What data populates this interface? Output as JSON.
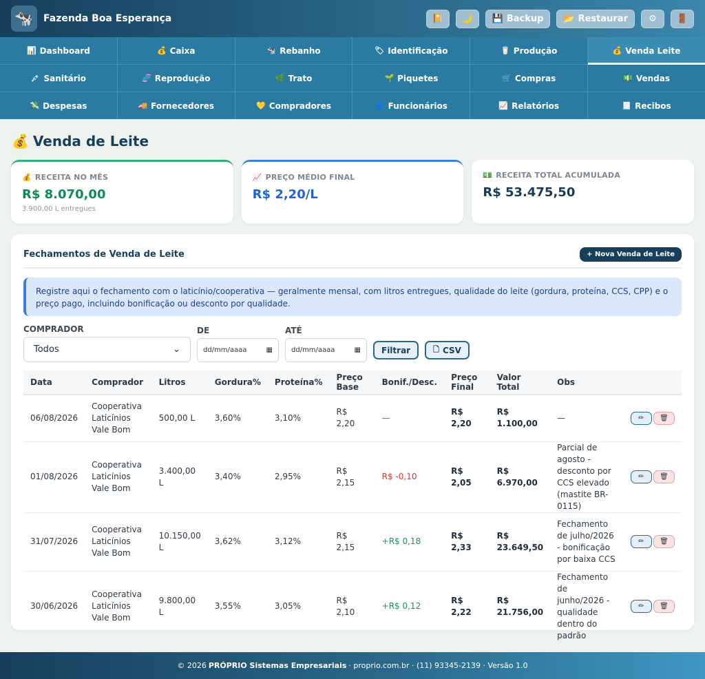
{
  "app": {
    "name": "Fazenda Boa Esperança",
    "logo_icon": "🐄"
  },
  "header": {
    "actions": [
      {
        "name": "notebook-button",
        "icon": "📔",
        "label": ""
      },
      {
        "name": "dark-mode-button",
        "icon": "🌙",
        "label": ""
      },
      {
        "name": "backup-button",
        "icon": "💾",
        "label": "Backup"
      },
      {
        "name": "restore-button",
        "icon": "📂",
        "label": "Restaurar"
      },
      {
        "name": "settings-button",
        "icon": "⚙",
        "label": ""
      },
      {
        "name": "logout-button",
        "icon": "🚪",
        "label": ""
      }
    ]
  },
  "nav": {
    "rows": [
      [
        {
          "icon": "📊",
          "label": "Dashboard"
        },
        {
          "icon": "💰",
          "label": "Caixa"
        },
        {
          "icon": "🐄",
          "label": "Rebanho"
        },
        {
          "icon": "🏷",
          "label": "Identificação"
        },
        {
          "icon": "🥛",
          "label": "Produção"
        },
        {
          "icon": "💰",
          "label": "Venda Leite",
          "active": true
        }
      ],
      [
        {
          "icon": "💉",
          "label": "Sanitário"
        },
        {
          "icon": "🧬",
          "label": "Reprodução"
        },
        {
          "icon": "🌿",
          "label": "Trato"
        },
        {
          "icon": "🌱",
          "label": "Piquetes"
        },
        {
          "icon": "🛒",
          "label": "Compras"
        },
        {
          "icon": "💵",
          "label": "Vendas"
        }
      ],
      [
        {
          "icon": "💸",
          "label": "Despesas"
        },
        {
          "icon": "🚚",
          "label": "Fornecedores"
        },
        {
          "icon": "💛",
          "label": "Compradores"
        },
        {
          "icon": "👤",
          "label": "Funcionários"
        },
        {
          "icon": "📈",
          "label": "Relatórios"
        },
        {
          "icon": "🧾",
          "label": "Recibos"
        }
      ]
    ]
  },
  "page": {
    "title": "Venda de Leite",
    "title_icon": "💰"
  },
  "cards": [
    {
      "icon": "💰",
      "label": "RECEITA NO MÊS",
      "value": "R$ 8.070,00",
      "sub": "3.900,00 L entregues",
      "accent": "#2fb07a"
    },
    {
      "icon": "📈",
      "label": "PREÇO MÉDIO FINAL",
      "value": "R$ 2,20/L",
      "sub": "",
      "accent": "#3a7fdc"
    },
    {
      "icon": "💵",
      "label": "RECEITA TOTAL ACUMULADA",
      "value": "R$ 53.475,50",
      "sub": "",
      "accent": ""
    }
  ],
  "panel": {
    "title": "Fechamentos de Venda de Leite",
    "new_button": "+ Nova Venda de Leite",
    "info": "Registre aqui o fechamento com o laticínio/cooperativa — geralmente mensal, com litros entregues, qualidade do leite (gordura, proteína, CCS, CPP) e o preço pago, incluindo bonificação ou desconto por qualidade."
  },
  "filters": {
    "buyer_label": "COMPRADOR",
    "buyer_value": "Todos",
    "from_label": "DE",
    "to_label": "ATÉ",
    "date_placeholder": "dd/mm/aaaa",
    "filter_button": "Filtrar",
    "csv_button": "CSV"
  },
  "table": {
    "columns": [
      "Data",
      "Comprador",
      "Litros",
      "Gordura%",
      "Proteína%",
      "Preço Base",
      "Bonif./Desc.",
      "Preço Final",
      "Valor Total",
      "Obs"
    ],
    "rows": [
      {
        "data": "06/08/2026",
        "comprador": "Cooperativa Laticínios Vale Bom",
        "litros": "500,00 L",
        "gordura": "3,60%",
        "proteina": "3,10%",
        "preco_base": "R$ 2,20",
        "bonif": "—",
        "bonif_type": "none",
        "preco_final": "R$ 2,20",
        "valor_total": "R$ 1.100,00",
        "obs": "—"
      },
      {
        "data": "01/08/2026",
        "comprador": "Cooperativa Laticínios Vale Bom",
        "litros": "3.400,00 L",
        "gordura": "3,40%",
        "proteina": "2,95%",
        "preco_base": "R$ 2,15",
        "bonif": "R$ -0,10",
        "bonif_type": "neg",
        "preco_final": "R$ 2,05",
        "valor_total": "R$ 6.970,00",
        "obs": "Parcial de agosto - desconto por CCS elevado (mastite BR-0115)"
      },
      {
        "data": "31/07/2026",
        "comprador": "Cooperativa Laticínios Vale Bom",
        "litros": "10.150,00 L",
        "gordura": "3,62%",
        "proteina": "3,12%",
        "preco_base": "R$ 2,15",
        "bonif": "+R$ 0,18",
        "bonif_type": "pos",
        "preco_final": "R$ 2,33",
        "valor_total": "R$ 23.649,50",
        "obs": "Fechamento de julho/2026 - bonificação por baixa CCS"
      },
      {
        "data": "30/06/2026",
        "comprador": "Cooperativa Laticínios Vale Bom",
        "litros": "9.800,00 L",
        "gordura": "3,55%",
        "proteina": "3,05%",
        "preco_base": "R$ 2,10",
        "bonif": "+R$ 0,12",
        "bonif_type": "pos",
        "preco_final": "R$ 2,22",
        "valor_total": "R$ 21.756,00",
        "obs": "Fechamento de junho/2026 - qualidade dentro do padrão"
      }
    ],
    "edit_icon": "✏",
    "delete_icon": "🗑"
  },
  "footer": {
    "prefix": "© 2026",
    "company": "PRÓPRIO Sistemas Empresariais",
    "suffix": "· proprio.com.br · (11) 93345-2139 · Versão 1.0"
  }
}
